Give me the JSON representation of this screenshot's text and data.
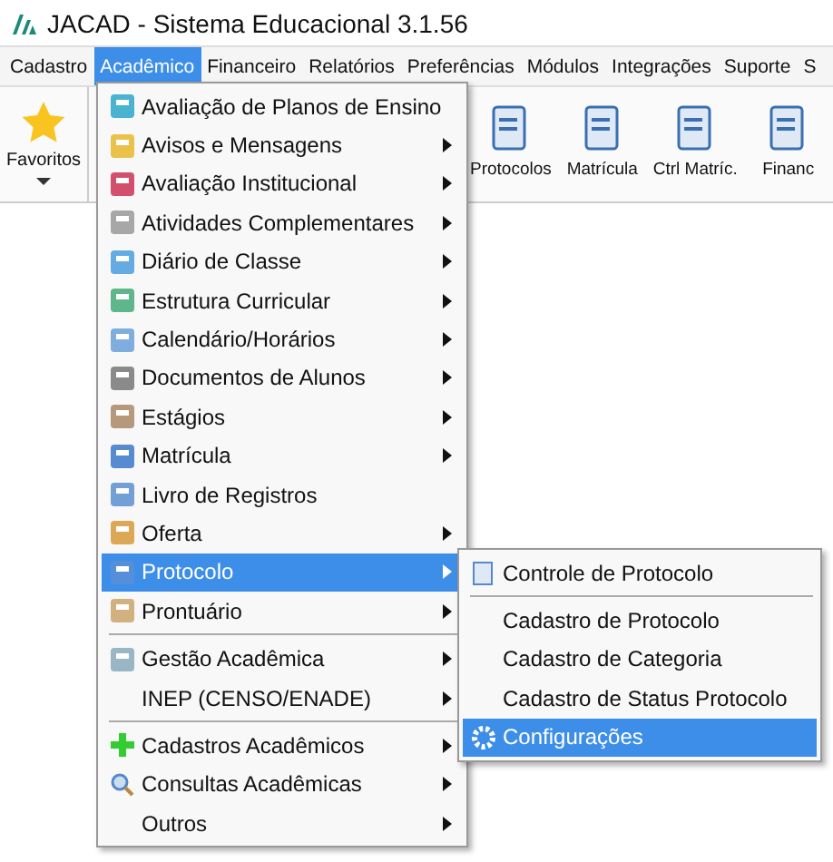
{
  "window": {
    "title": "JACAD - Sistema Educacional 3.1.56"
  },
  "menubar": [
    {
      "label": "Cadastro",
      "selected": false
    },
    {
      "label": "Acadêmico",
      "selected": true
    },
    {
      "label": "Financeiro",
      "selected": false
    },
    {
      "label": "Relatórios",
      "selected": false
    },
    {
      "label": "Preferências",
      "selected": false
    },
    {
      "label": "Módulos",
      "selected": false
    },
    {
      "label": "Integrações",
      "selected": false
    },
    {
      "label": "Suporte",
      "selected": false
    },
    {
      "label": "S",
      "selected": false
    }
  ],
  "toolbar": {
    "favorites": {
      "label": "Favoritos"
    },
    "buttons": [
      {
        "label": "Protocolos"
      },
      {
        "label": "Matrícula"
      },
      {
        "label": "Ctrl Matríc."
      },
      {
        "label": "Financ"
      }
    ]
  },
  "menu": [
    {
      "kind": "item",
      "label": "Avaliação de Planos de Ensino",
      "submenu": false,
      "selected": false
    },
    {
      "kind": "item",
      "label": "Avisos e Mensagens",
      "submenu": true,
      "selected": false
    },
    {
      "kind": "item",
      "label": "Avaliação Institucional",
      "submenu": true,
      "selected": false
    },
    {
      "kind": "item",
      "label": "Atividades Complementares",
      "submenu": true,
      "selected": false
    },
    {
      "kind": "item",
      "label": "Diário de Classe",
      "submenu": true,
      "selected": false
    },
    {
      "kind": "item",
      "label": "Estrutura Curricular",
      "submenu": true,
      "selected": false
    },
    {
      "kind": "item",
      "label": "Calendário/Horários",
      "submenu": true,
      "selected": false
    },
    {
      "kind": "item",
      "label": "Documentos de Alunos",
      "submenu": true,
      "selected": false
    },
    {
      "kind": "item",
      "label": "Estágios",
      "submenu": true,
      "selected": false
    },
    {
      "kind": "item",
      "label": "Matrícula",
      "submenu": true,
      "selected": false
    },
    {
      "kind": "item",
      "label": "Livro de Registros",
      "submenu": false,
      "selected": false
    },
    {
      "kind": "item",
      "label": "Oferta",
      "submenu": true,
      "selected": false
    },
    {
      "kind": "item",
      "label": "Protocolo",
      "submenu": true,
      "selected": true
    },
    {
      "kind": "item",
      "label": "Prontuário",
      "submenu": true,
      "selected": false
    },
    {
      "kind": "separator"
    },
    {
      "kind": "item",
      "label": "Gestão Acadêmica",
      "submenu": true,
      "selected": false
    },
    {
      "kind": "item",
      "label": "INEP (CENSO/ENADE)",
      "submenu": true,
      "selected": false
    },
    {
      "kind": "separator"
    },
    {
      "kind": "item",
      "label": "Cadastros Acadêmicos",
      "submenu": true,
      "selected": false
    },
    {
      "kind": "item",
      "label": "Consultas Acadêmicas",
      "submenu": true,
      "selected": false
    },
    {
      "kind": "item",
      "label": "Outros",
      "submenu": true,
      "selected": false
    }
  ],
  "submenu": [
    {
      "kind": "item",
      "label": "Controle de Protocolo",
      "selected": false
    },
    {
      "kind": "separator"
    },
    {
      "kind": "item",
      "label": "Cadastro de Protocolo",
      "selected": false
    },
    {
      "kind": "item",
      "label": "Cadastro de Categoria",
      "selected": false
    },
    {
      "kind": "item",
      "label": "Cadastro de Status Protocolo",
      "selected": false
    },
    {
      "kind": "item",
      "label": "Configurações",
      "selected": true
    }
  ]
}
